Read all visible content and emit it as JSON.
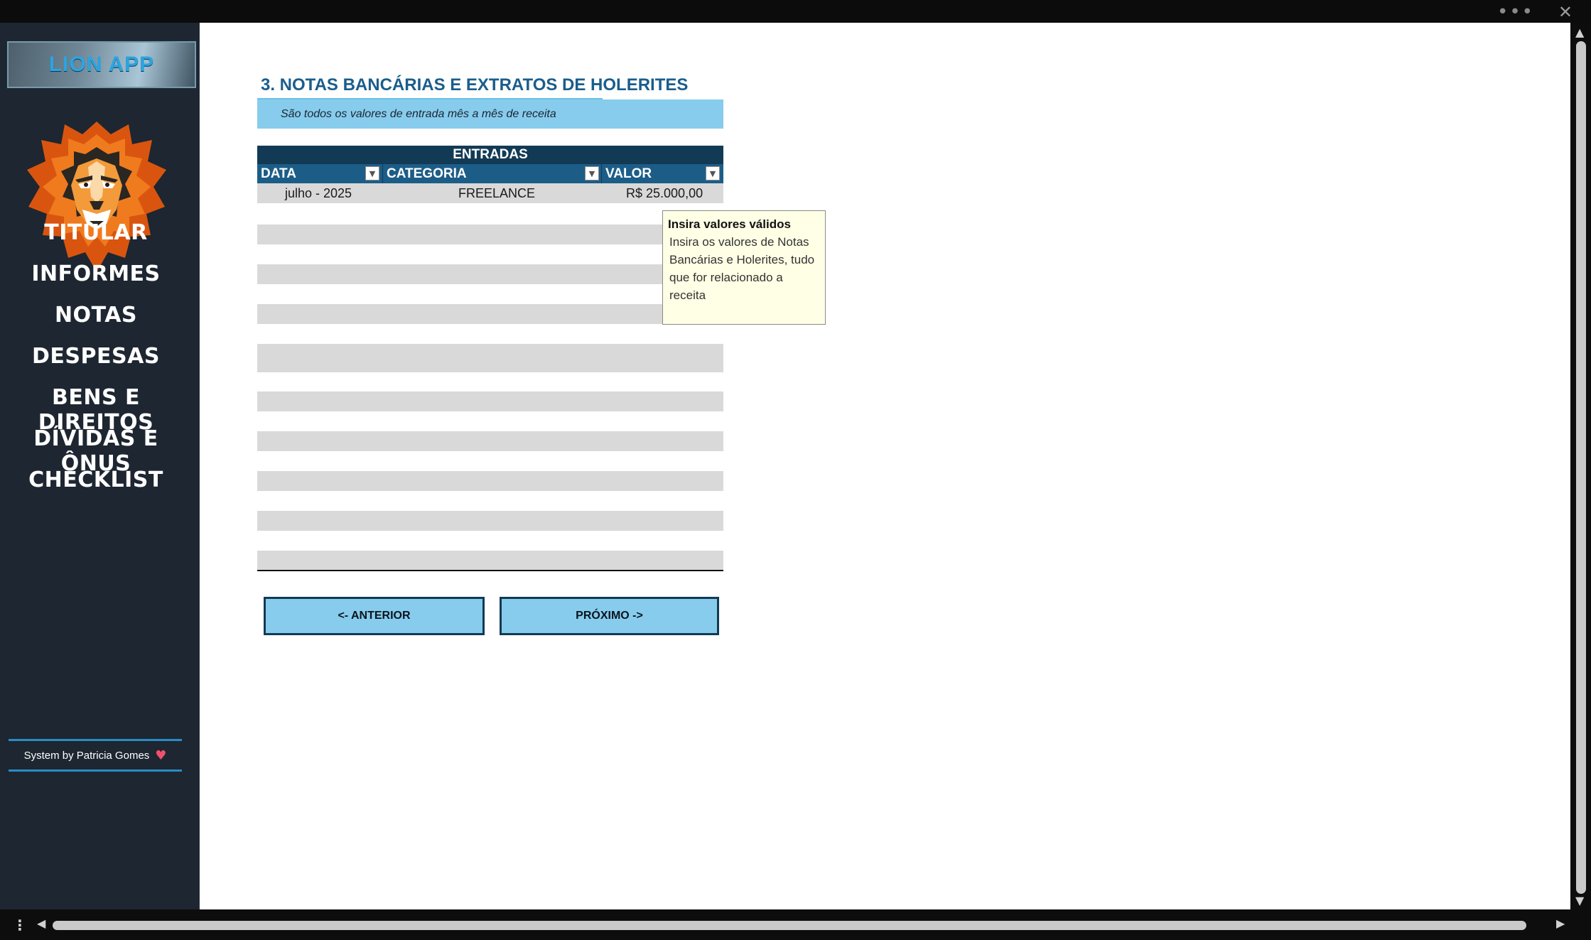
{
  "app": {
    "logo_label": "LION APP",
    "credit": "System by Patricia Gomes"
  },
  "nav": {
    "items": [
      {
        "label": "TITULAR"
      },
      {
        "label": "INFORMES"
      },
      {
        "label": "NOTAS"
      },
      {
        "label": "DESPESAS"
      },
      {
        "label": "BENS E DIREITOS"
      },
      {
        "label": "DÍVIDAS E ÔNUS"
      },
      {
        "label": "CHECKLIST"
      }
    ]
  },
  "page": {
    "title": "3. NOTAS BANCÁRIAS E EXTRATOS DE HOLERITES",
    "subtitle": "São todos os valores de entrada mês a mês de receita"
  },
  "table": {
    "title": "ENTRADAS",
    "columns": [
      "DATA",
      "CATEGORIA",
      "VALOR"
    ],
    "rows": [
      {
        "data": "julho - 2025",
        "categoria": "FREELANCE",
        "valor": "R$ 25.000,00"
      }
    ]
  },
  "tooltip": {
    "title": "Insira valores válidos",
    "body": "Insira os valores de Notas Bancárias e Holerites, tudo que for relacionado a receita"
  },
  "buttons": {
    "previous": "<- ANTERIOR",
    "next": "PRÓXIMO ->"
  },
  "colors": {
    "sidebar_bg": "#1d2631",
    "header_dark": "#123a55",
    "header_mid": "#1c5d88",
    "accent_light_blue": "#87ccec",
    "title_blue": "#1a5d8c",
    "row_gray": "#d9d9d9",
    "tooltip_bg": "#ffffe6"
  },
  "icons": {
    "logo": "lion-head-icon",
    "heart": "heart-icon",
    "filter": "filter-dropdown-icon"
  }
}
